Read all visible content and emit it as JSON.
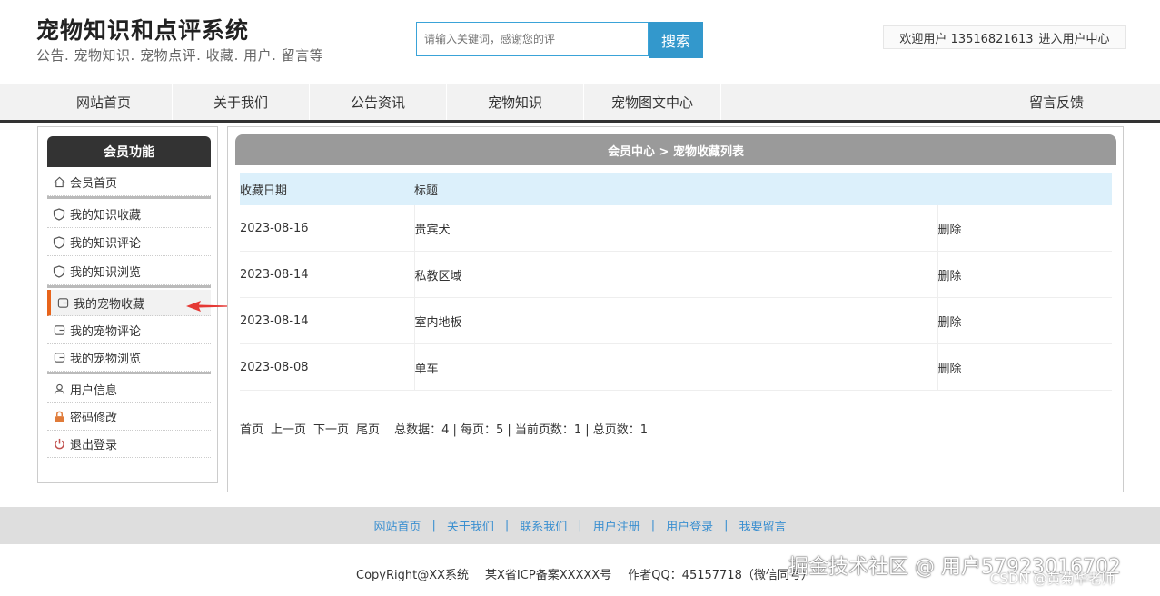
{
  "header": {
    "title": "宠物知识和点评系统",
    "subtitle": "公告. 宠物知识. 宠物点评. 收藏. 用户. 留言等",
    "search_placeholder": "请输入关键词，感谢您的评",
    "search_button": "搜索",
    "welcome": "欢迎用户 13516821613",
    "user_center": "进入用户中心"
  },
  "nav": {
    "items": [
      "网站首页",
      "关于我们",
      "公告资讯",
      "宠物知识",
      "宠物图文中心",
      "留言反馈"
    ]
  },
  "sidebar": {
    "title": "会员功能",
    "items": [
      {
        "label": "会员首页",
        "icon": "home-icon"
      },
      {
        "label": "我的知识收藏",
        "icon": "shield-icon"
      },
      {
        "label": "我的知识评论",
        "icon": "shield-icon"
      },
      {
        "label": "我的知识浏览",
        "icon": "shield-icon"
      },
      {
        "label": "我的宠物收藏",
        "icon": "card-icon"
      },
      {
        "label": "我的宠物评论",
        "icon": "card-icon"
      },
      {
        "label": "我的宠物浏览",
        "icon": "card-icon"
      },
      {
        "label": "用户信息",
        "icon": "user-icon"
      },
      {
        "label": "密码修改",
        "icon": "lock-icon"
      },
      {
        "label": "退出登录",
        "icon": "power-icon"
      }
    ],
    "active_index": 4
  },
  "main": {
    "heading": "会员中心 > 宠物收藏列表",
    "columns": [
      "收藏日期",
      "标题",
      ""
    ],
    "rows": [
      {
        "date": "2023-08-16",
        "title": "贵宾犬",
        "action": "删除"
      },
      {
        "date": "2023-08-14",
        "title": "私教区域",
        "action": "删除"
      },
      {
        "date": "2023-08-14",
        "title": "室内地板",
        "action": "删除"
      },
      {
        "date": "2023-08-08",
        "title": "单车",
        "action": "删除"
      }
    ],
    "pager": {
      "first": "首页",
      "prev": "上一页",
      "next": "下一页",
      "last": "尾页",
      "summary": "总数据：4 | 每页：5 | 当前页数：1 | 总页数：1"
    }
  },
  "footer": {
    "links": [
      "网站首页",
      "关于我们",
      "联系我们",
      "用户注册",
      "用户登录",
      "我要留言"
    ],
    "copyright": "CopyRight@XX系统",
    "icp": "某X省ICP备案XXXXX号",
    "author": "作者QQ：45157718（微信同号）",
    "watermark": "掘金技术社区 @ 用户57923016702",
    "watermark_csdn": "CSDN @黄菊华老师"
  },
  "colors": {
    "accent_blue": "#3398cc",
    "active_marker": "#e8641b",
    "arrow_red": "#e53935",
    "table_head_bg": "#dcf0fb",
    "footer_link": "#3a8fd0"
  }
}
